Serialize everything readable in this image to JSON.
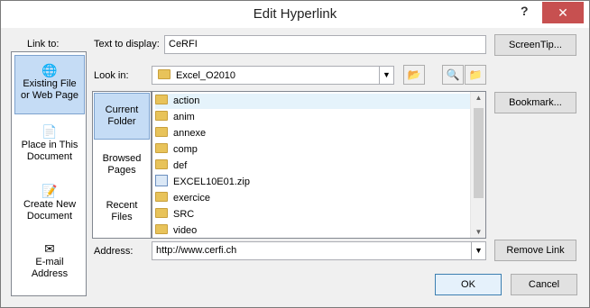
{
  "window": {
    "title": "Edit Hyperlink",
    "help_glyph": "?",
    "close_glyph": "✕"
  },
  "link_to": {
    "label": "Link to:",
    "items": [
      {
        "label_line1": "Existing File",
        "label_line2": "or Web Page",
        "icon": "globe-file-icon",
        "selected": true
      },
      {
        "label_line1": "Place in This",
        "label_line2": "Document",
        "icon": "document-place-icon",
        "selected": false
      },
      {
        "label_line1": "Create New",
        "label_line2": "Document",
        "icon": "new-document-icon",
        "selected": false
      },
      {
        "label_line1": "E-mail",
        "label_line2": "Address",
        "icon": "email-icon",
        "selected": false
      }
    ]
  },
  "text_to_display": {
    "label": "Text to display:",
    "value": "CeRFI"
  },
  "screentip_button": "ScreenTip...",
  "look_in": {
    "label": "Look in:",
    "value": "Excel_O2010"
  },
  "side_tabs": [
    {
      "line1": "Current",
      "line2": "Folder",
      "selected": true
    },
    {
      "line1": "Browsed",
      "line2": "Pages",
      "selected": false
    },
    {
      "line1": "Recent",
      "line2": "Files",
      "selected": false
    }
  ],
  "files": [
    {
      "name": "action",
      "type": "folder"
    },
    {
      "name": "anim",
      "type": "folder"
    },
    {
      "name": "annexe",
      "type": "folder"
    },
    {
      "name": "comp",
      "type": "folder"
    },
    {
      "name": "def",
      "type": "folder"
    },
    {
      "name": "EXCEL10E01.zip",
      "type": "zip"
    },
    {
      "name": "exercice",
      "type": "folder"
    },
    {
      "name": "SRC",
      "type": "folder"
    },
    {
      "name": "video",
      "type": "folder"
    }
  ],
  "bookmark_button": "Bookmark...",
  "address": {
    "label": "Address:",
    "value": "http://www.cerfi.ch"
  },
  "remove_link_button": "Remove Link",
  "ok_button": "OK",
  "cancel_button": "Cancel",
  "colors": {
    "selection": "#c5dcf5",
    "close": "#c75050"
  }
}
